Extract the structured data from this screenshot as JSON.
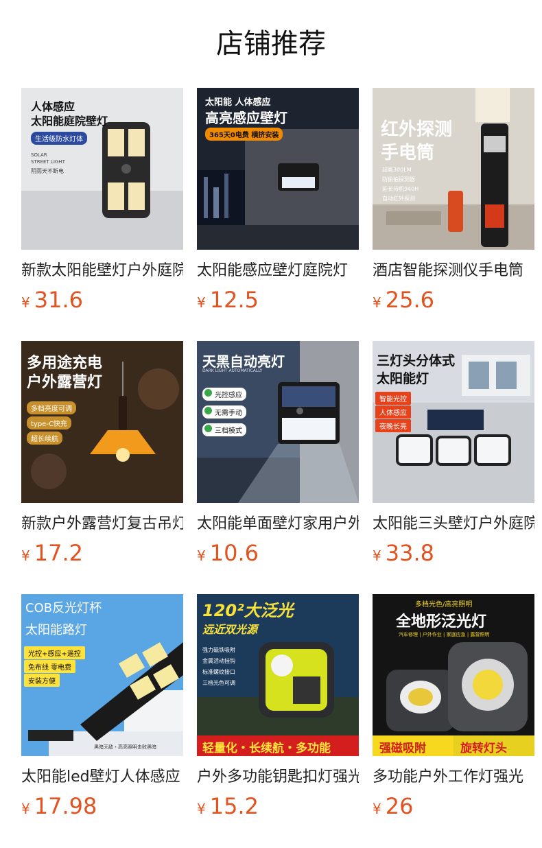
{
  "header": {
    "title": "店铺推荐"
  },
  "currency": "¥",
  "products": [
    {
      "name": "新款太阳能壁灯户外庭院",
      "price": "31.6",
      "image": {
        "headline": [
          "人体感应",
          "太阳能庭院壁灯"
        ],
        "badge": "生活级防水灯体",
        "notes": [
          "SOLAR",
          "STREET LIGHT",
          "阴雨天不断电"
        ]
      }
    },
    {
      "name": "太阳能感应壁灯庭院灯",
      "price": "12.5",
      "image": {
        "headline": [
          "太阳能 人体感应",
          "高亮感应壁灯"
        ],
        "badge": "365天0电费 横挤安装"
      }
    },
    {
      "name": "酒店智能探测仪手电筒",
      "price": "25.6",
      "image": {
        "headline": [
          "红外探测",
          "手电筒"
        ],
        "notes": [
          "超高300LM",
          "防偷拍探测器",
          "延长待机940H",
          "自动红外探测"
        ]
      }
    },
    {
      "name": "新款户外露营灯复古吊灯",
      "price": "17.2",
      "image": {
        "headline": [
          "多用途充电",
          "户外露营灯"
        ],
        "tags": [
          "多档亮度可调",
          "type-C快充",
          "超长续航"
        ]
      }
    },
    {
      "name": "太阳能单面壁灯家用户外",
      "price": "10.6",
      "image": {
        "headline": [
          "天黑自动亮灯"
        ],
        "subline": "DARK LIGHT AUTOMATICALLY",
        "tags": [
          "光控感应",
          "无需手动",
          "三档模式"
        ]
      }
    },
    {
      "name": "太阳能三头壁灯户外庭院",
      "price": "33.8",
      "image": {
        "headline": [
          "三灯头分体式",
          "太阳能灯"
        ],
        "tags": [
          "智能光控",
          "人体感应",
          "夜晚长亮"
        ]
      }
    },
    {
      "name": "太阳能led壁灯人体感应",
      "price": "17.98",
      "image": {
        "headline": [
          "COB反光灯杯",
          "太阳能路灯"
        ],
        "tags": [
          "光控+感应+遥控",
          "免布线 零电费",
          "安装方便"
        ],
        "caption": "黑暗天敌・高亮照明击败黑暗"
      }
    },
    {
      "name": "户外多功能钥匙扣灯强光",
      "price": "15.2",
      "image": {
        "headline": [
          "120²大泛光",
          "远近双光源"
        ],
        "notes": [
          "强力磁铁吸附",
          "金属活动挂钩",
          "标准螺纹接口",
          "三档光色可调"
        ],
        "banner": "轻量化・长续航・多功能"
      }
    },
    {
      "name": "多功能户外工作灯强光",
      "price": "26",
      "image": {
        "headline": [
          "多档光色/高亮照明",
          "全地形泛光灯"
        ],
        "notes": [
          "汽车修理 | 户外作业 | 家庭应急 | 露营照明"
        ],
        "banners": [
          "强磁吸附",
          "旋转灯头"
        ]
      }
    }
  ],
  "colors": {
    "price": "#e2531f",
    "title": "#111111",
    "text": "#222222"
  }
}
